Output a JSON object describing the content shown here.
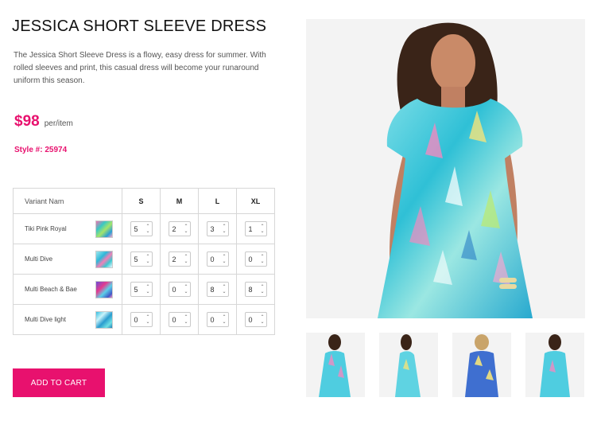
{
  "product": {
    "title": "JESSICA SHORT SLEEVE DRESS",
    "description": "The Jessica Short Sleeve Dress is a flowy, easy dress for summer. With rolled sleeves and print, this casual dress will become your runaround uniform this season.",
    "price": "$98",
    "price_unit": "per/item",
    "style": "Style #: 25974"
  },
  "table": {
    "variant_header": "Variant Nam",
    "sizes": [
      "S",
      "M",
      "L",
      "XL"
    ],
    "rows": [
      {
        "name": "Tiki Pink Royal",
        "qty": [
          "5",
          "2",
          "3",
          "1"
        ]
      },
      {
        "name": "Multi Dive",
        "qty": [
          "5",
          "2",
          "0",
          "0"
        ]
      },
      {
        "name": "Multi Beach & Bae",
        "qty": [
          "5",
          "0",
          "8",
          "8"
        ]
      },
      {
        "name": "Multi Dive light",
        "qty": [
          "0",
          "0",
          "0",
          "0"
        ]
      }
    ]
  },
  "actions": {
    "add_to_cart": "ADD TO CART"
  },
  "colors": {
    "accent": "#e8116e"
  }
}
